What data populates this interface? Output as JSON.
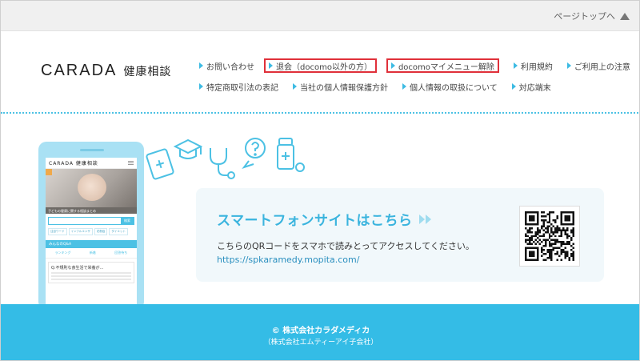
{
  "topbar": {
    "page_top_label": "ページトップへ"
  },
  "header": {
    "logo": "CARADA",
    "logo_sub": "健康相談"
  },
  "nav": {
    "row1": [
      {
        "label": "お問い合わせ",
        "highlight": false
      },
      {
        "label": "退会（docomo以外の方）",
        "highlight": true
      },
      {
        "label": "docomoマイメニュー解除",
        "highlight": true
      },
      {
        "label": "利用規約",
        "highlight": false
      },
      {
        "label": "ご利用上の注意",
        "highlight": false
      }
    ],
    "row2": [
      {
        "label": "特定商取引法の表記"
      },
      {
        "label": "当社の個人情報保護方針"
      },
      {
        "label": "個人情報の取扱について"
      },
      {
        "label": "対応端末"
      }
    ]
  },
  "phone": {
    "logo": "CARADA 健康相談",
    "caption": "子どもの健康に関する相談まとめ",
    "search_placeholder": "気になるキーワードを入力",
    "search_button": "検索",
    "tags": [
      "注目ワード",
      "インフルエンザ",
      "花粉症",
      "ダイエット"
    ],
    "section": "みんなのQ&A",
    "tabs": [
      "ランキング",
      "新着",
      "回答待ち"
    ],
    "question": "Q.不規則な食生活で栄養が…"
  },
  "card": {
    "title": "スマートフォンサイトはこちら",
    "description": "こちらのQRコードをスマホで読みとってアクセスしてください。",
    "url": "https://spkaramedy.mopita.com/"
  },
  "footer": {
    "copyright": "© 株式会社カラダメディカ",
    "sub": "（株式会社エムティーアイ子会社）"
  },
  "colors": {
    "accent": "#34bce6",
    "highlight_border": "#e0303a",
    "text": "#333333"
  }
}
